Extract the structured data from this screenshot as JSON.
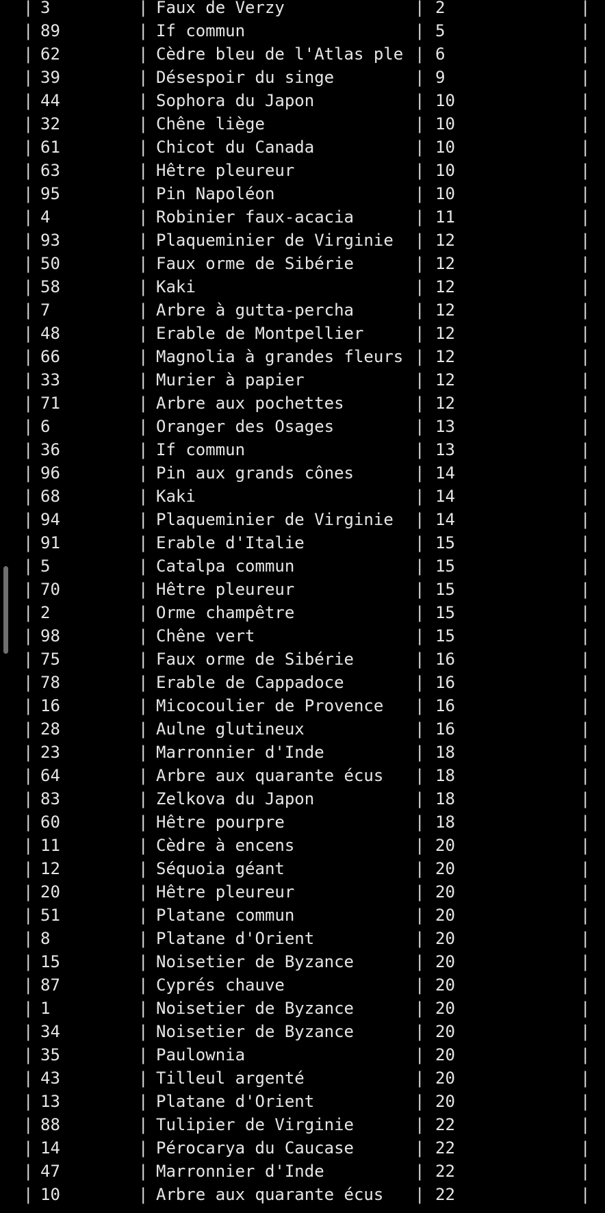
{
  "terminal": {
    "separator": "|",
    "rows": [
      {
        "id": "3",
        "name": "Faux de Verzy",
        "value": "2"
      },
      {
        "id": "89",
        "name": "If commun",
        "value": "5"
      },
      {
        "id": "62",
        "name": "Cèdre bleu de l'Atlas ple",
        "value": "6"
      },
      {
        "id": "39",
        "name": "Désespoir du singe",
        "value": "9"
      },
      {
        "id": "44",
        "name": "Sophora du Japon",
        "value": "10"
      },
      {
        "id": "32",
        "name": "Chêne liège",
        "value": "10"
      },
      {
        "id": "61",
        "name": "Chicot du Canada",
        "value": "10"
      },
      {
        "id": "63",
        "name": "Hêtre pleureur",
        "value": "10"
      },
      {
        "id": "95",
        "name": "Pin Napoléon",
        "value": "10"
      },
      {
        "id": "4",
        "name": "Robinier faux-acacia",
        "value": "11"
      },
      {
        "id": "93",
        "name": "Plaqueminier de Virginie",
        "value": "12"
      },
      {
        "id": "50",
        "name": "Faux orme de Sibérie",
        "value": "12"
      },
      {
        "id": "58",
        "name": "Kaki",
        "value": "12"
      },
      {
        "id": "7",
        "name": "Arbre à gutta-percha",
        "value": "12"
      },
      {
        "id": "48",
        "name": "Erable de Montpellier",
        "value": "12"
      },
      {
        "id": "66",
        "name": "Magnolia à grandes fleurs",
        "value": "12"
      },
      {
        "id": "33",
        "name": "Murier à papier",
        "value": "12"
      },
      {
        "id": "71",
        "name": "Arbre aux pochettes",
        "value": "12"
      },
      {
        "id": "6",
        "name": "Oranger des Osages",
        "value": "13"
      },
      {
        "id": "36",
        "name": "If commun",
        "value": "13"
      },
      {
        "id": "96",
        "name": "Pin aux grands cônes",
        "value": "14"
      },
      {
        "id": "68",
        "name": "Kaki",
        "value": "14"
      },
      {
        "id": "94",
        "name": "Plaqueminier de Virginie",
        "value": "14"
      },
      {
        "id": "91",
        "name": "Erable d'Italie",
        "value": "15"
      },
      {
        "id": "5",
        "name": "Catalpa commun",
        "value": "15"
      },
      {
        "id": "70",
        "name": "Hêtre pleureur",
        "value": "15"
      },
      {
        "id": "2",
        "name": "Orme champêtre",
        "value": "15"
      },
      {
        "id": "98",
        "name": "Chêne vert",
        "value": "15"
      },
      {
        "id": "75",
        "name": "Faux orme de Sibérie",
        "value": "16"
      },
      {
        "id": "78",
        "name": "Erable de Cappadoce",
        "value": "16"
      },
      {
        "id": "16",
        "name": "Micocoulier de Provence",
        "value": "16"
      },
      {
        "id": "28",
        "name": "Aulne glutineux",
        "value": "16"
      },
      {
        "id": "23",
        "name": "Marronnier d'Inde",
        "value": "18"
      },
      {
        "id": "64",
        "name": "Arbre aux quarante écus",
        "value": "18"
      },
      {
        "id": "83",
        "name": "Zelkova du Japon",
        "value": "18"
      },
      {
        "id": "60",
        "name": "Hêtre pourpre",
        "value": "18"
      },
      {
        "id": "11",
        "name": "Cèdre à encens",
        "value": "20"
      },
      {
        "id": "12",
        "name": "Séquoia géant",
        "value": "20"
      },
      {
        "id": "20",
        "name": "Hêtre pleureur",
        "value": "20"
      },
      {
        "id": "51",
        "name": "Platane commun",
        "value": "20"
      },
      {
        "id": "8",
        "name": "Platane d'Orient",
        "value": "20"
      },
      {
        "id": "15",
        "name": "Noisetier de Byzance",
        "value": "20"
      },
      {
        "id": "87",
        "name": "Cyprés chauve",
        "value": "20"
      },
      {
        "id": "1",
        "name": "Noisetier de Byzance",
        "value": "20"
      },
      {
        "id": "34",
        "name": "Noisetier de Byzance",
        "value": "20"
      },
      {
        "id": "35",
        "name": "Paulownia",
        "value": "20"
      },
      {
        "id": "43",
        "name": "Tilleul argenté",
        "value": "20"
      },
      {
        "id": "13",
        "name": "Platane d'Orient",
        "value": "20"
      },
      {
        "id": "88",
        "name": "Tulipier de Virginie",
        "value": "22"
      },
      {
        "id": "14",
        "name": "Pérocarya du Caucase",
        "value": "22"
      },
      {
        "id": "47",
        "name": "Marronnier d'Inde",
        "value": "22"
      },
      {
        "id": "10",
        "name": "Arbre aux quarante écus",
        "value": "22"
      }
    ]
  }
}
